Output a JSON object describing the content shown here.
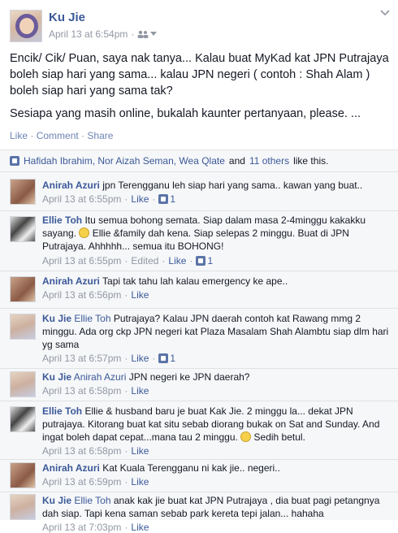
{
  "post": {
    "author": "Ku Jie",
    "timestamp": "April 13 at 6:54pm",
    "sep": "·",
    "paragraph1": "Encik/ Cik/ Puan, saya nak tanya... Kalau buat MyKad kat JPN Putrajaya boleh siap hari yang sama... kalau JPN negeri ( contoh : Shah Alam ) boleh siap hari yang sama tak?",
    "paragraph2": "Sesiapa yang masih online, bukalah kaunter pertanyaan, please. ...",
    "actions": {
      "like": "Like",
      "comment": "Comment",
      "share": "Share",
      "sep": "·"
    }
  },
  "likes_bar": {
    "names": "Hafidah Ibrahim, Nor Aizah Seman, Wea Qlate",
    "and": "and",
    "others": "11 others",
    "tail": "like this."
  },
  "comments": [
    {
      "name": "Anirah Azuri",
      "avatar": "anirah",
      "text": "jpn Terengganu leh siap hari yang sama.. kawan yang buat..",
      "time": "April 13 at 6:55pm",
      "like": "Like",
      "likes": "1"
    },
    {
      "name": "Ellie Toh",
      "avatar": "ellie",
      "text1": "Itu semua bohong semata. Siap dalam masa 2-4minggu kakakku sayang.",
      "text2": "Ellie &family dah kena. Siap selepas 2 minggu. Buat di JPN Putrajaya. Ahhhhh... semua itu BOHONG!",
      "time": "April 13 at 6:55pm",
      "edited": "Edited",
      "like": "Like",
      "likes": "1"
    },
    {
      "name": "Anirah Azuri",
      "avatar": "anirah",
      "text": "Tapi tak tahu lah kalau emergency ke ape..",
      "time": "April 13 at 6:56pm",
      "like": "Like"
    },
    {
      "name": "Ku Jie",
      "avatar": "ku",
      "mention": "Ellie Toh",
      "text": "Putrajaya? Kalau JPN daerah contoh kat Rawang mmg 2 minggu. Ada org ckp JPN negeri kat Plaza Masalam Shah Alambtu siap dlm hari yg sama",
      "time": "April 13 at 6:57pm",
      "like": "Like",
      "likes": "1"
    },
    {
      "name": "Ku Jie",
      "avatar": "ku",
      "mention": "Anirah Azuri",
      "text": "JPN negeri ke JPN daerah?",
      "time": "April 13 at 6:58pm",
      "like": "Like"
    },
    {
      "name": "Ellie Toh",
      "avatar": "ellie",
      "text1": "Ellie & husband baru je buat Kak Jie. 2 minggu la... dekat JPN putrajaya. Kitorang buat kat situ sebab diorang bukak on Sat and Sunday. And ingat boleh dapat cepat...mana tau 2 minggu.",
      "text2": "Sedih betul.",
      "time": "April 13 at 6:58pm",
      "like": "Like"
    },
    {
      "name": "Anirah Azuri",
      "avatar": "anirah",
      "text": "Kat Kuala Terengganu ni kak jie.. negeri..",
      "time": "April 13 at 6:59pm",
      "like": "Like"
    },
    {
      "name": "Ku Jie",
      "avatar": "ku",
      "mention": "Ellie Toh",
      "text": "anak kak jie buat kat JPN Putrajaya , dia buat pagi petangnya dah siap. Tapi kena saman sebab park kereta tepi jalan... hahaha",
      "time": "April 13 at 7:03pm",
      "like": "Like"
    }
  ],
  "colors": {
    "link": "#3b5998",
    "meta": "#9197a3",
    "comment_bg": "#f6f7f9"
  }
}
